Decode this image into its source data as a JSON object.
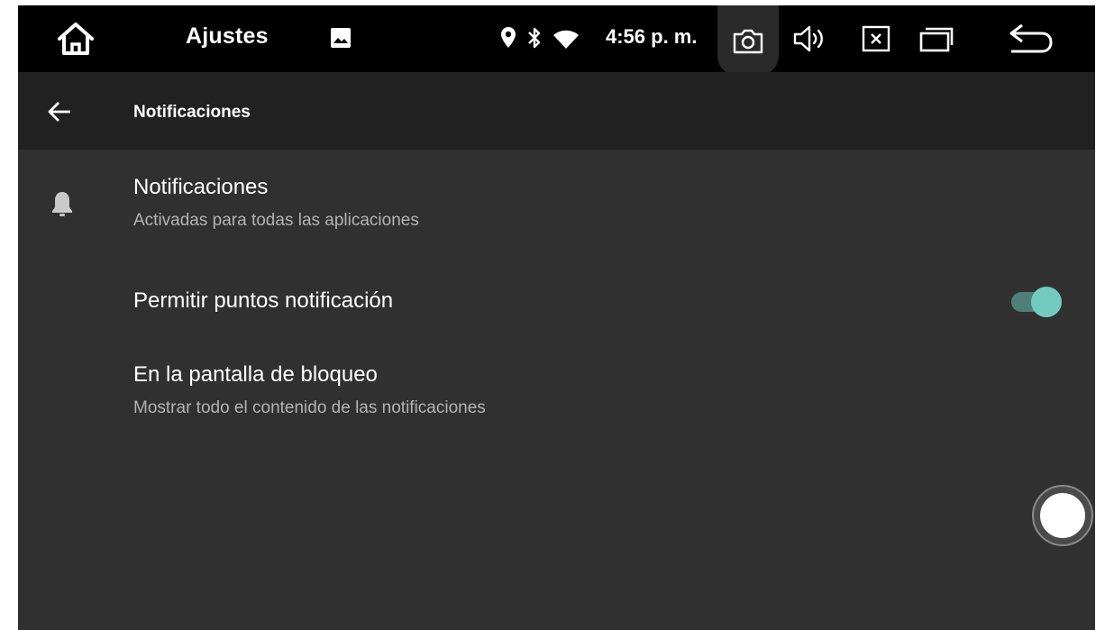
{
  "statusbar": {
    "app_title": "Ajustes",
    "time": "4:56 p. m.",
    "icons": [
      "home-icon",
      "gallery-icon",
      "location-icon",
      "bluetooth-icon",
      "wifi-icon",
      "camera-icon",
      "volume-icon",
      "close-icon",
      "recent-apps-icon",
      "back-icon"
    ]
  },
  "appbar": {
    "title": "Notificaciones"
  },
  "settings": {
    "notifications": {
      "title": "Notificaciones",
      "summary": "Activadas para todas las aplicaciones"
    },
    "dots": {
      "title": "Permitir puntos notificación",
      "enabled": true
    },
    "lockscreen": {
      "title": "En la pantalla de bloqueo",
      "summary": "Mostrar todo el contenido de las notificaciones"
    }
  },
  "colors": {
    "background": "#303030",
    "appbar": "#212121",
    "statusbar": "#000000",
    "accent": "#73cbc0"
  }
}
